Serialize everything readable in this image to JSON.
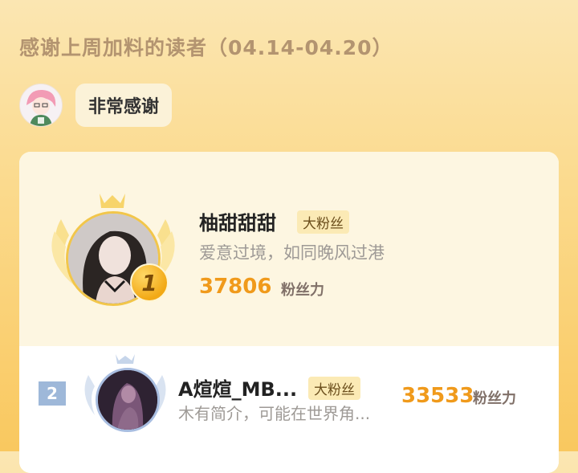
{
  "header": {
    "title": "感谢上周加料的读者（04.14-04.20）"
  },
  "thanks": {
    "bubble_text": "非常感谢"
  },
  "ranking": [
    {
      "rank": "1",
      "name": "柚甜甜甜",
      "badge": "大粉丝",
      "bio": "爱意过境，如同晚风过港",
      "count": "37806",
      "unit": "粉丝力"
    },
    {
      "rank": "2",
      "name": "A煊煊_MB...",
      "badge": "大粉丝",
      "bio": "木有简介，可能在世界角...",
      "count": "33533",
      "unit": "粉丝力"
    }
  ],
  "colors": {
    "accent": "#f09a1b",
    "gold": "#f2c64a",
    "silver": "#a8bde0"
  }
}
